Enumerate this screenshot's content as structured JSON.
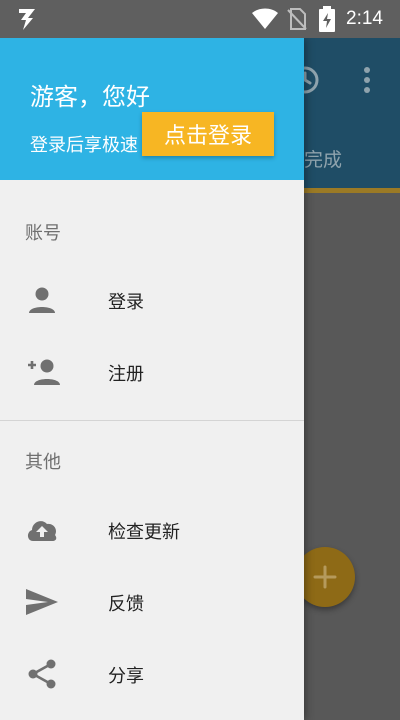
{
  "status_bar": {
    "time": "2:14",
    "icons": [
      "flash-app-icon",
      "wifi-icon",
      "no-sim-icon",
      "battery-charging-icon"
    ]
  },
  "background": {
    "tab_text_partial": "完成",
    "icons": [
      "history-icon",
      "more-vert-icon",
      "add-icon"
    ],
    "fab_color": "#8e6a16"
  },
  "drawer": {
    "header": {
      "greeting": "游客，您好",
      "subtitle": "登录后享极速",
      "login_button": "点击登录",
      "bg_color": "#2eb3e4",
      "button_color": "#f7b623"
    },
    "sections": [
      {
        "title": "账号",
        "items": [
          {
            "label": "登录",
            "icon": "person-icon"
          },
          {
            "label": "注册",
            "icon": "person-add-icon"
          }
        ]
      },
      {
        "title": "其他",
        "items": [
          {
            "label": "检查更新",
            "icon": "cloud-upload-icon"
          },
          {
            "label": "反馈",
            "icon": "send-icon"
          },
          {
            "label": "分享",
            "icon": "share-icon"
          }
        ]
      }
    ]
  }
}
